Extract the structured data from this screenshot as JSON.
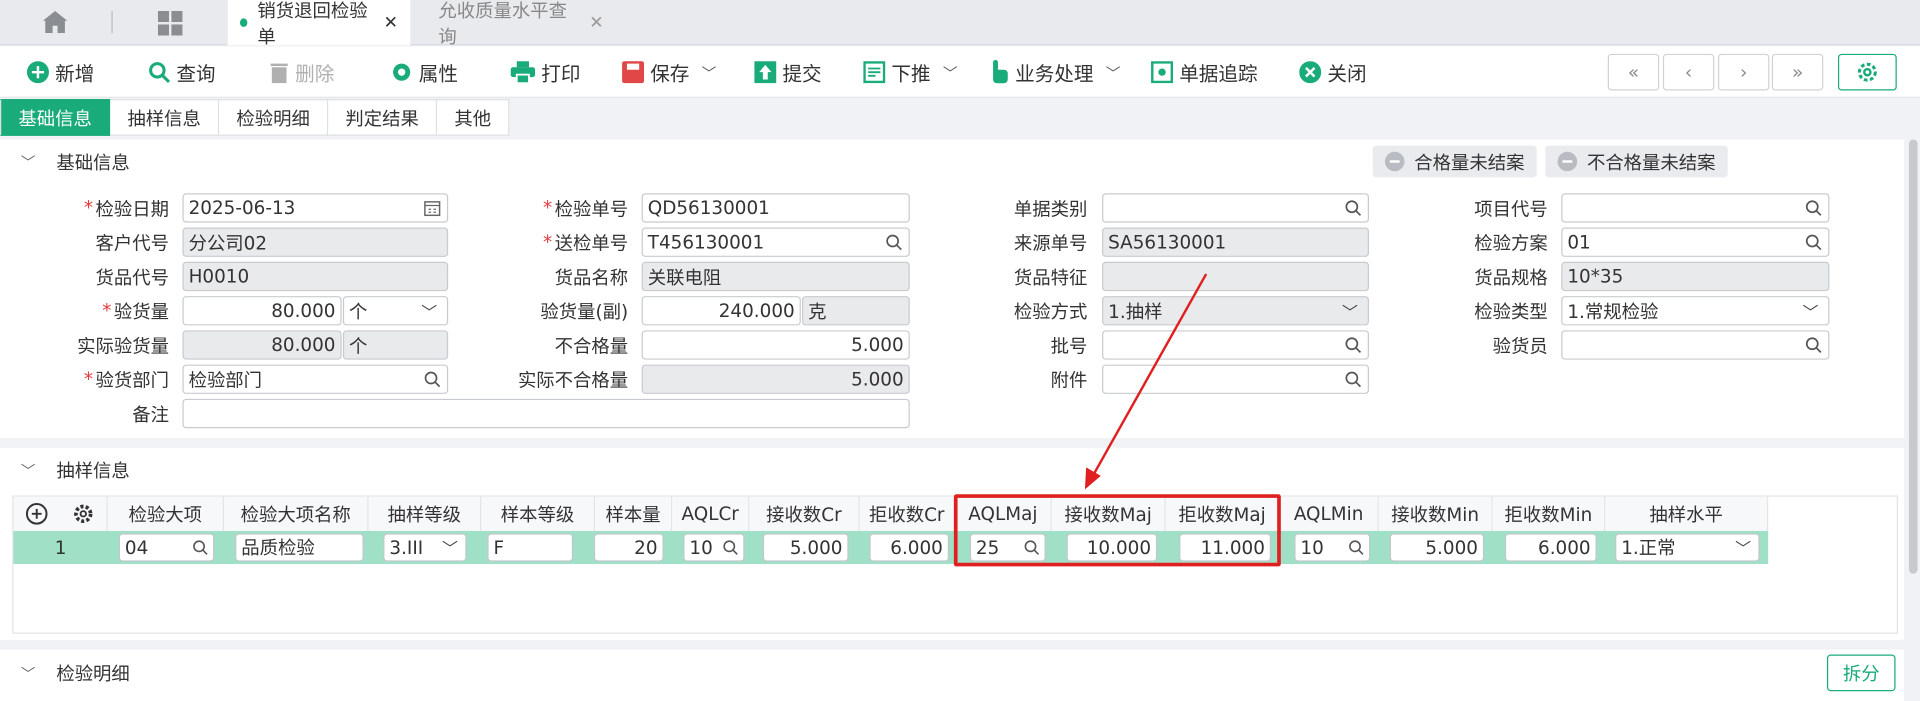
{
  "tabs": [
    {
      "label": "销货退回检验单",
      "active": true
    },
    {
      "label": "允收质量水平查询",
      "active": false
    }
  ],
  "toolbar": {
    "new": "新增",
    "query": "查询",
    "delete": "删除",
    "attr": "属性",
    "print": "打印",
    "save": "保存",
    "submit": "提交",
    "push_down": "下推",
    "business": "业务处理",
    "trace": "单据追踪",
    "close": "关闭"
  },
  "subtabs": [
    "基础信息",
    "抽样信息",
    "检验明细",
    "判定结果",
    "其他"
  ],
  "basic": {
    "title": "基础信息",
    "pill_pass": "合格量未结案",
    "pill_fail": "不合格量未结案",
    "labels": {
      "inspect_date": "检验日期",
      "customer": "客户代号",
      "goods_code": "货品代号",
      "inspect_qty": "验货量",
      "actual_qty": "实际验货量",
      "dept": "验货部门",
      "remark": "备注",
      "inspect_no": "检验单号",
      "send_no": "送检单号",
      "goods_name": "货品名称",
      "qty_sub": "验货量(副)",
      "unqualified": "不合格量",
      "actual_unqualified": "实际不合格量",
      "doc_type": "单据类别",
      "source_no": "来源单号",
      "goods_feature": "货品特征",
      "method": "检验方式",
      "batch": "批号",
      "attach": "附件",
      "item_code": "项目代号",
      "plan": "检验方案",
      "goods_spec": "货品规格",
      "inspect_type": "检验类型",
      "inspector": "验货员"
    },
    "values": {
      "inspect_date": "2025-06-13",
      "customer": "分公司02",
      "goods_code": "H0010",
      "inspect_qty": "80.000",
      "inspect_unit": "个",
      "actual_qty": "80.000",
      "actual_unit": "个",
      "dept": "检验部门",
      "remark": "",
      "inspect_no": "QD56130001",
      "send_no": "T456130001",
      "goods_name": "关联电阻",
      "qty_sub": "240.000",
      "qty_sub_unit": "克",
      "unqualified": "5.000",
      "actual_unqualified": "5.000",
      "doc_type": "",
      "source_no": "SA56130001",
      "goods_feature": "",
      "method": "1.抽样",
      "batch": "",
      "attach": "",
      "item_code": "",
      "plan": "01",
      "goods_spec": "10*35",
      "inspect_type": "1.常规检验",
      "inspector": ""
    }
  },
  "sampling": {
    "title": "抽样信息",
    "columns": [
      "检验大项",
      "检验大项名称",
      "抽样等级",
      "样本等级",
      "样本量",
      "AQLCr",
      "接收数Cr",
      "拒收数Cr",
      "AQLMaj",
      "接收数Maj",
      "拒收数Maj",
      "AQLMin",
      "接收数Min",
      "拒收数Min",
      "抽样水平"
    ],
    "row": {
      "index": "1",
      "item": "04",
      "item_name": "品质检验",
      "level": "3.III",
      "sample_level": "F",
      "sample_qty": "20",
      "aql_cr": "10",
      "accept_cr": "5.000",
      "reject_cr": "6.000",
      "aql_maj": "25",
      "accept_maj": "10.000",
      "reject_maj": "11.000",
      "aql_min": "10",
      "accept_min": "5.000",
      "reject_min": "6.000",
      "sampling_level": "1.正常"
    }
  },
  "detail": {
    "title": "检验明细",
    "split": "拆分"
  },
  "colors": {
    "accent": "#1aab7b",
    "required": "#e03b3b",
    "highlight": "#e02020"
  }
}
